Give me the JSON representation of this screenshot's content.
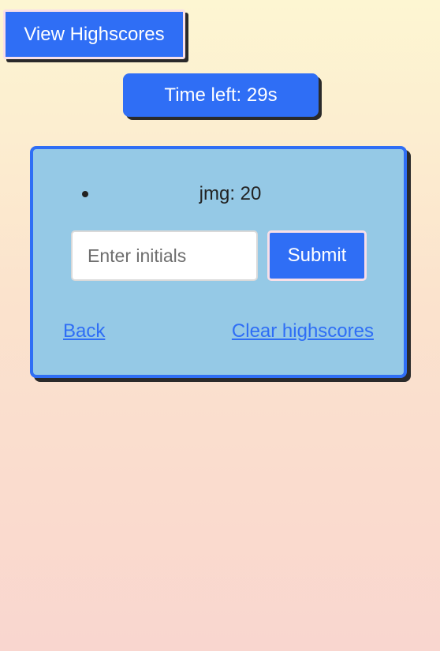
{
  "header": {
    "view_highscores_label": "View Highscores",
    "timer_text": "Time left: 29s"
  },
  "highscores": {
    "entries": [
      {
        "text": "jmg: 20"
      }
    ]
  },
  "form": {
    "initials_placeholder": "Enter initials",
    "initials_value": "",
    "submit_label": "Submit"
  },
  "links": {
    "back_label": "Back",
    "clear_label": "Clear highscores"
  },
  "colors": {
    "accent": "#2f6ef5",
    "card_background": "#95c9e6",
    "button_border": "#f8dfe8",
    "background_top": "#fdf6d2",
    "background_bottom": "#f9d6cf"
  }
}
